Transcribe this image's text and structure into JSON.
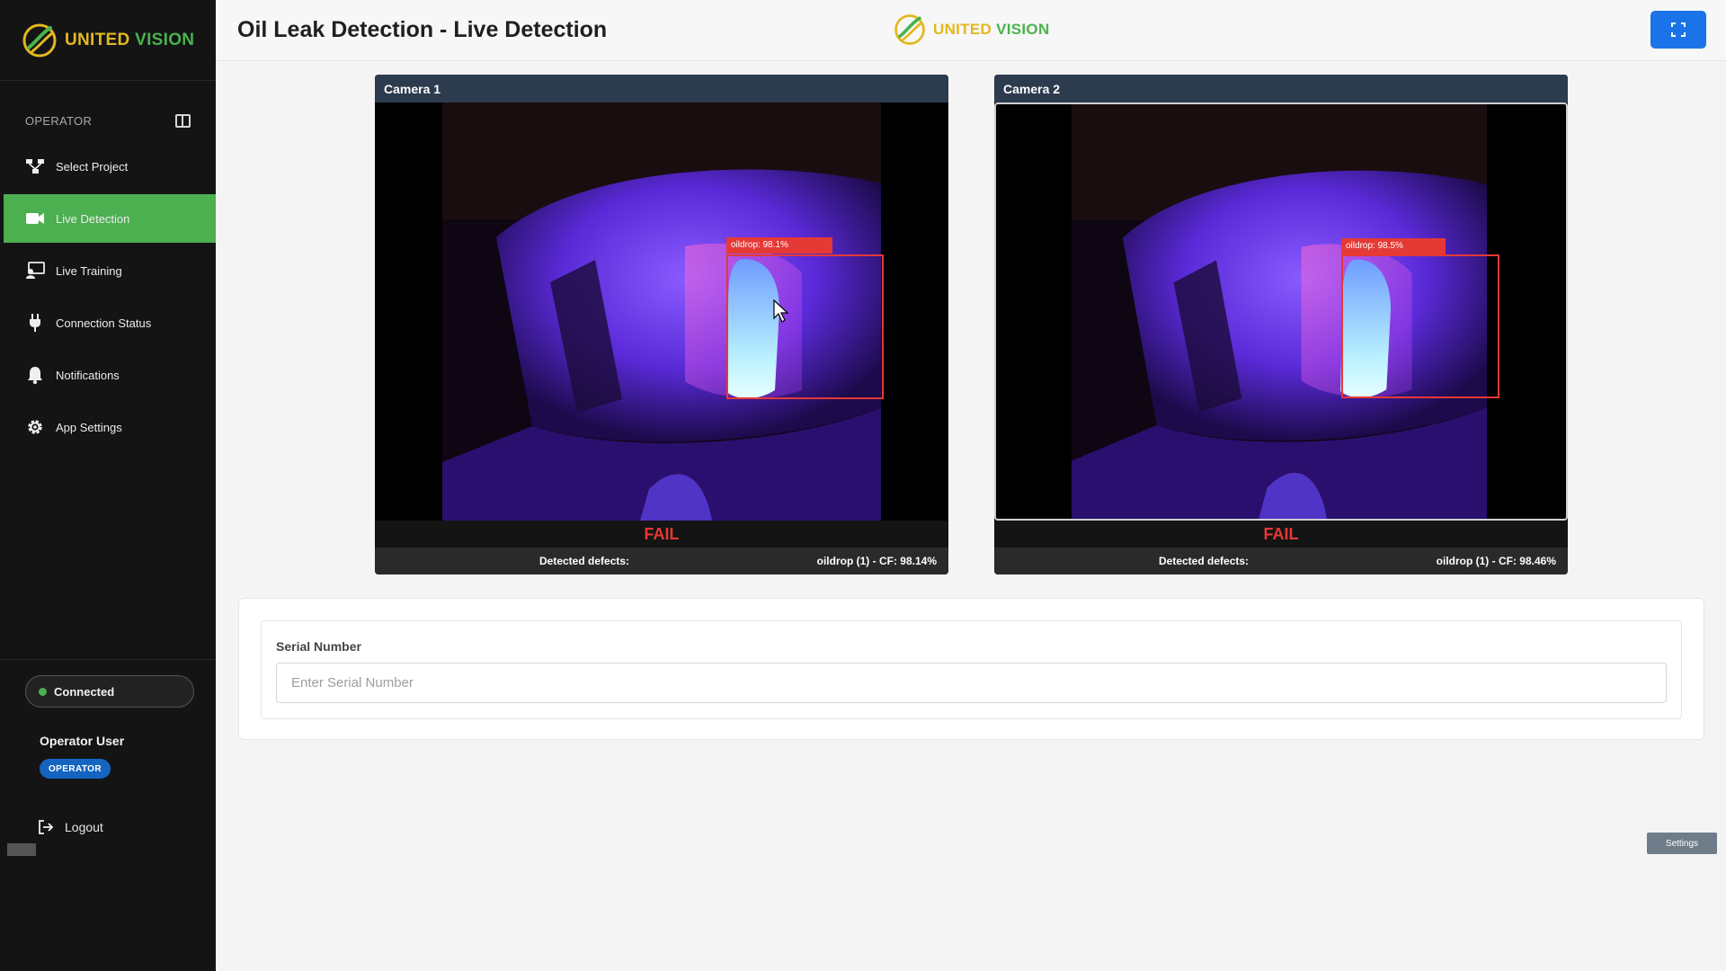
{
  "brand": {
    "name_part1": "UNITED",
    "name_part2": "VISION"
  },
  "sidebar": {
    "section_label": "OPERATOR",
    "items": [
      {
        "label": "Select Project",
        "icon": "project-icon"
      },
      {
        "label": "Live Detection",
        "icon": "video-camera-icon",
        "active": true
      },
      {
        "label": "Live Training",
        "icon": "training-icon"
      },
      {
        "label": "Connection Status",
        "icon": "plug-icon"
      },
      {
        "label": "Notifications",
        "icon": "bell-icon"
      },
      {
        "label": "App Settings",
        "icon": "gear-icon"
      }
    ],
    "connection": "Connected",
    "user_name": "Operator User",
    "role_badge": "OPERATOR",
    "logout": "Logout"
  },
  "header": {
    "title": "Oil Leak Detection - Live Detection"
  },
  "cameras": [
    {
      "title": "Camera 1",
      "detection_label": "oildrop: 98.1%",
      "status": "FAIL",
      "defects_label": "Detected defects:",
      "defects_value": "oildrop (1) - CF: 98.14%"
    },
    {
      "title": "Camera 2",
      "detection_label": "oildrop: 98.5%",
      "status": "FAIL",
      "defects_label": "Detected defects:",
      "defects_value": "oildrop (1) - CF: 98.46%"
    }
  ],
  "serial": {
    "label": "Serial Number",
    "placeholder": "Enter Serial Number",
    "value": ""
  },
  "settings_button": "Settings",
  "colors": {
    "accent_green": "#4caf50",
    "primary_blue": "#1a73e8",
    "fail_red": "#e53935",
    "sidebar_bg": "#141414",
    "camera_header": "#2d3b4e"
  }
}
